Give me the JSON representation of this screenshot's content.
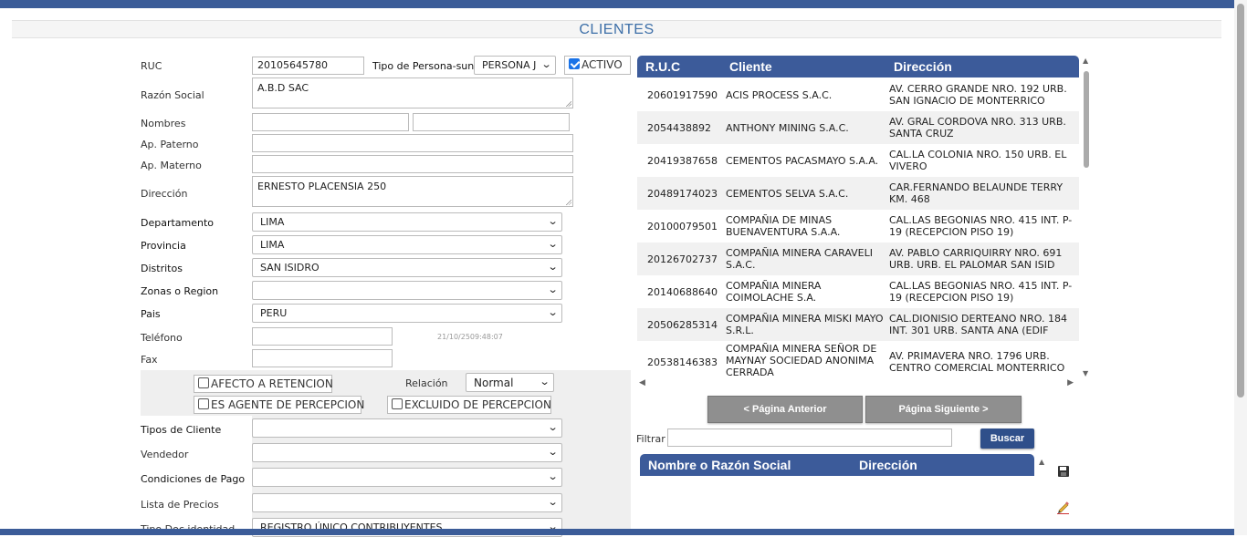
{
  "page": {
    "title": "CLIENTES"
  },
  "form": {
    "ruc_label": "RUC",
    "ruc_value": "20105645780",
    "tipo_persona_label": "Tipo de Persona-sunat",
    "tipo_persona_value": "PERSONA J",
    "activo_label": "ACTIVO",
    "razon_social_label": "Razón Social",
    "razon_social_value": "A.B.D SAC",
    "nombres_label": "Nombres",
    "nombres_value_1": "",
    "nombres_value_2": "",
    "ap_paterno_label": "Ap. Paterno",
    "ap_paterno_value": "",
    "ap_materno_label": "Ap. Materno",
    "ap_materno_value": "",
    "direccion_label": "Dirección",
    "direccion_value": "ERNESTO PLACENSIA 250",
    "departamento_label": "Departamento",
    "departamento_value": "LIMA",
    "provincia_label": "Provincia",
    "provincia_value": "LIMA",
    "distritos_label": "Distritos",
    "distritos_value": "SAN ISIDRO",
    "zonas_label": "Zonas o Region",
    "zonas_value": "",
    "pais_label": "Pais",
    "pais_value": "PERU",
    "telefono_label": "Teléfono",
    "telefono_value": "",
    "timestamp": "21/10/2509:48:07",
    "fax_label": "Fax",
    "fax_value": "",
    "afecto_retencion_label": "AFECTO A RETENCION",
    "relacion_label": "Relación",
    "relacion_value": "Normal",
    "agente_percepcion_label": "ES AGENTE DE PERCEPCION",
    "excluido_percepcion_label": "EXCLUIDO DE PERCEPCION",
    "tipos_cliente_label": "Tipos de Cliente",
    "tipos_cliente_value": "",
    "vendedor_label": "Vendedor",
    "vendedor_value": "",
    "condiciones_pago_label": "Condiciones de Pago",
    "condiciones_pago_value": "",
    "lista_precios_label": "Lista de Precios",
    "lista_precios_value": "",
    "tipo_doc_label": "Tipo Doc identidad",
    "tipo_doc_value": "REGISTRO ÚNICO CONTRIBUYENTES"
  },
  "clients_table": {
    "headers": {
      "ruc": "R.U.C",
      "cliente": "Cliente",
      "direccion": "Dirección"
    },
    "rows": [
      {
        "ruc": "20601917590",
        "cliente": "ACIS PROCESS S.A.C.",
        "direccion": "AV. CERRO GRANDE NRO. 192 URB. SAN IGNACIO DE MONTERRICO"
      },
      {
        "ruc": "2054438892",
        "cliente": "ANTHONY MINING S.A.C.",
        "direccion": "AV. GRAL CORDOVA NRO. 313 URB. SANTA CRUZ"
      },
      {
        "ruc": "20419387658",
        "cliente": "CEMENTOS PACASMAYO S.A.A.",
        "direccion": "CAL.LA COLONIA NRO. 150 URB. EL VIVERO"
      },
      {
        "ruc": "20489174023",
        "cliente": "CEMENTOS SELVA S.A.C.",
        "direccion": "CAR.FERNANDO BELAUNDE TERRY KM. 468"
      },
      {
        "ruc": "20100079501",
        "cliente": "COMPAÑIA DE MINAS BUENAVENTURA S.A.A.",
        "direccion": "CAL.LAS BEGONIAS NRO. 415 INT. P-19 (RECEPCION PISO 19)"
      },
      {
        "ruc": "20126702737",
        "cliente": "COMPAÑIA MINERA CARAVELI S.A.C.",
        "direccion": "AV. PABLO CARRIQUIRRY NRO. 691 URB. URB. EL PALOMAR SAN ISID"
      },
      {
        "ruc": "20140688640",
        "cliente": "COMPAÑIA MINERA COIMOLACHE S.A.",
        "direccion": "CAL.LAS BEGONIAS NRO. 415 INT. P-19 (RECEPCION PISO 19)"
      },
      {
        "ruc": "20506285314",
        "cliente": "COMPAÑIA MINERA MISKI MAYO S.R.L.",
        "direccion": "CAL.DIONISIO DERTEANO NRO. 184 INT. 301 URB. SANTA ANA (EDIF"
      },
      {
        "ruc": "20538146383",
        "cliente": "COMPAÑIA MINERA SEÑOR DE MAYNAY SOCIEDAD ANONIMA CERRADA",
        "direccion": "AV. PRIMAVERA NRO. 1796 URB. CENTRO COMERCIAL MONTERRICO"
      }
    ]
  },
  "pagination": {
    "prev_label": "< Página Anterior",
    "next_label": "Página Siguiente >"
  },
  "filter": {
    "label": "Filtrar",
    "value": "",
    "search_label": "Buscar"
  },
  "second_table": {
    "headers": {
      "nombre": "Nombre o Razón Social",
      "direccion": "Dirección"
    }
  },
  "icons": {
    "save": "floppy-disk-icon",
    "edit": "pencil-icon"
  },
  "colors": {
    "header_blue": "#3c5b9a",
    "title_blue": "#3d6fa8",
    "button_gray": "#8f8f8f",
    "search_button": "#2f4f8a"
  }
}
